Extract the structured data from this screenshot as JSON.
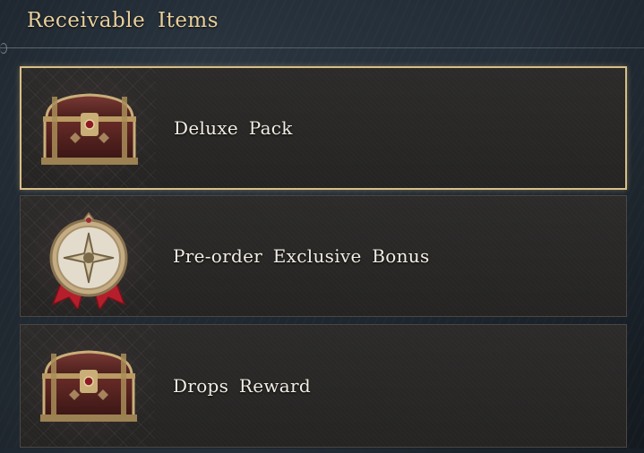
{
  "header": {
    "title": "Receivable Items"
  },
  "items": [
    {
      "label": "Deluxe Pack",
      "icon": "treasure-chest-icon",
      "selected": true
    },
    {
      "label": "Pre-order Exclusive Bonus",
      "icon": "medal-icon",
      "selected": false
    },
    {
      "label": "Drops Reward",
      "icon": "treasure-chest-icon",
      "selected": false
    }
  ],
  "colors": {
    "title": "#e8cf9c",
    "selection_border": "#d8bf86",
    "panel": "#2a2928",
    "label": "#f2ede4"
  }
}
